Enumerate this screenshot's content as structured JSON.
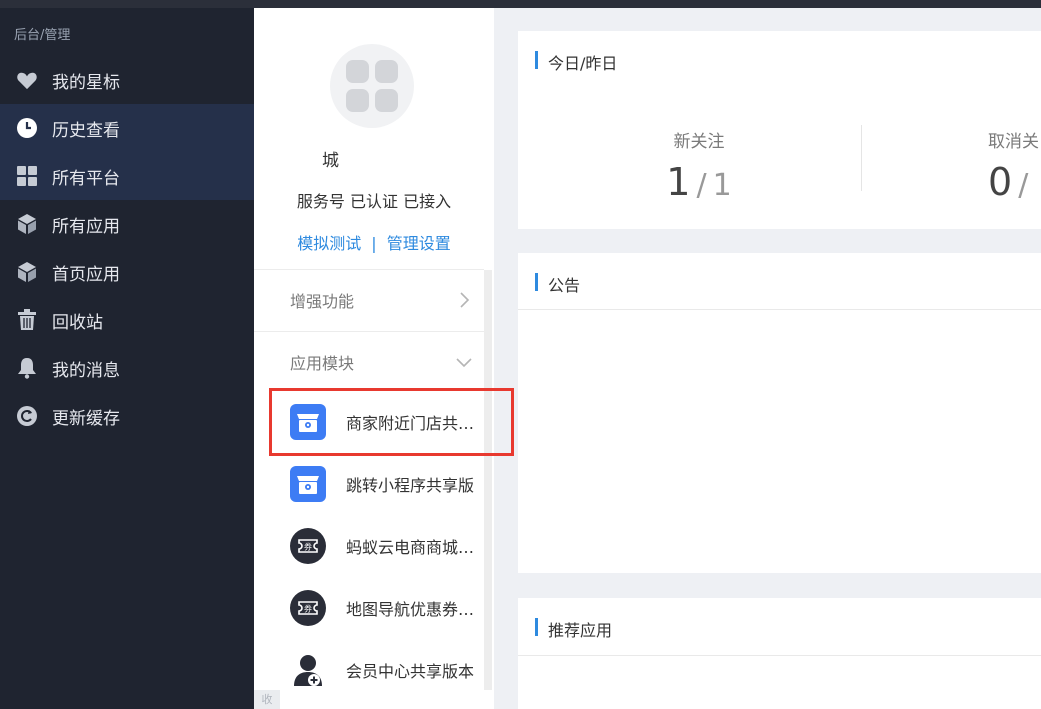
{
  "sidebar": {
    "section_title": "后台/管理",
    "items": [
      {
        "label": "我的星标",
        "icon": "heart-icon"
      },
      {
        "label": "历史查看",
        "icon": "clock-icon",
        "active": true
      },
      {
        "label": "所有平台",
        "icon": "grid-icon",
        "active": true
      },
      {
        "label": "所有应用",
        "icon": "cube-icon"
      },
      {
        "label": "首页应用",
        "icon": "cube-icon"
      },
      {
        "label": "回收站",
        "icon": "trash-icon"
      },
      {
        "label": "我的消息",
        "icon": "bell-icon"
      },
      {
        "label": "更新缓存",
        "icon": "refresh-icon"
      }
    ]
  },
  "account": {
    "name": "城",
    "status": "服务号 已认证 已接入",
    "links": [
      "模拟测试",
      "管理设置"
    ],
    "link_separator": "|"
  },
  "menu": {
    "enhance": "增强功能",
    "modules": "应用模块"
  },
  "apps": [
    {
      "label": "商家附近门店共…",
      "icon": "store-icon",
      "highlighted": true
    },
    {
      "label": "跳转小程序共享版",
      "icon": "store-icon"
    },
    {
      "label": "蚂蚁云电商商城…",
      "icon": "coupon-icon"
    },
    {
      "label": "地图导航优惠券…",
      "icon": "coupon-icon"
    },
    {
      "label": "会员中心共享版本",
      "icon": "member-icon"
    }
  ],
  "collapse_tab": "收",
  "cards": {
    "today": {
      "title": "今日/昨日",
      "stats": [
        {
          "label": "新关注",
          "today": "1",
          "yesterday": "1"
        },
        {
          "label": "取消关",
          "today": "0",
          "yesterday": ""
        }
      ]
    },
    "notice": {
      "title": "公告"
    },
    "recommend": {
      "title": "推荐应用"
    }
  },
  "colors": {
    "sidebar_bg": "#1f2430",
    "sidebar_active": "#25304a",
    "accent": "#2e8adf",
    "highlight": "#e8392f"
  }
}
